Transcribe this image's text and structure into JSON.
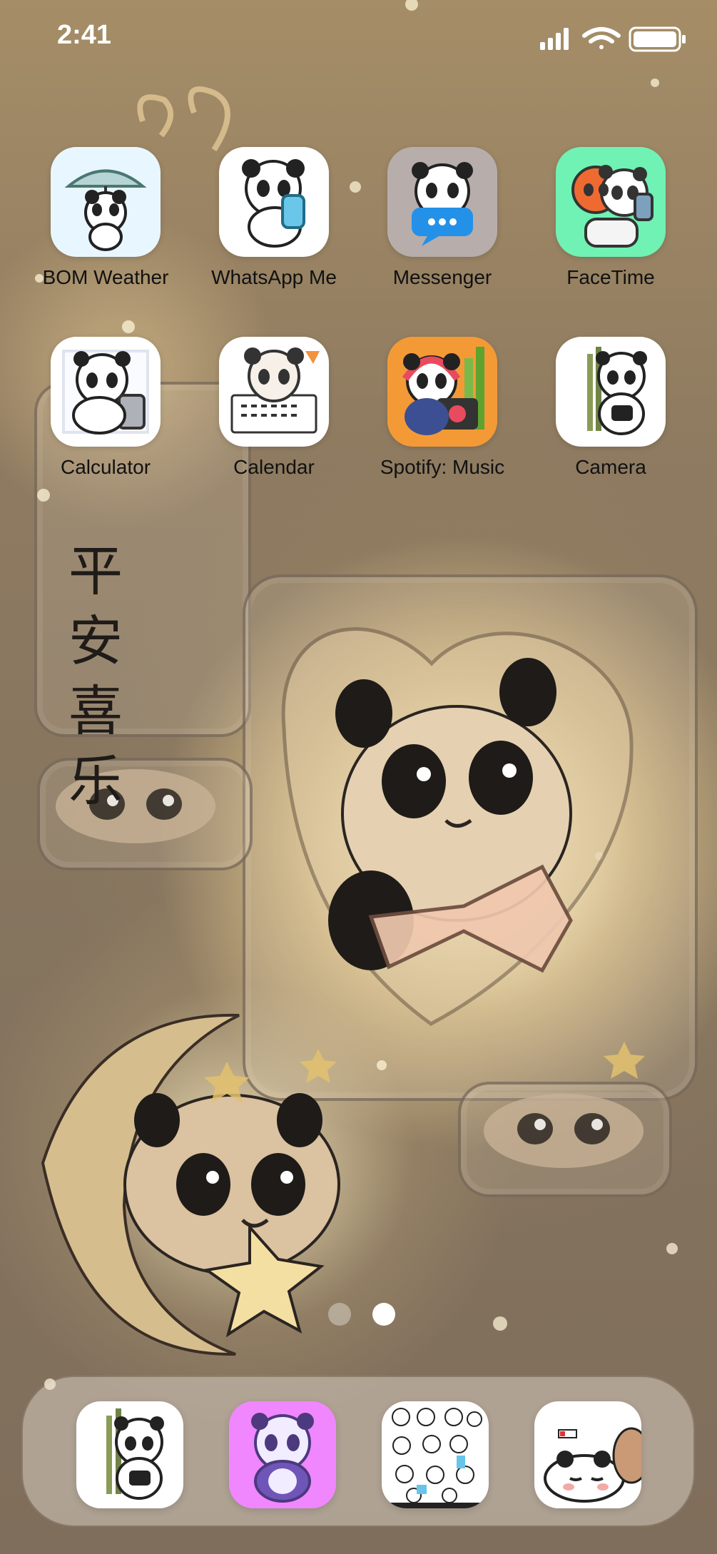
{
  "status_bar": {
    "time": "2:41",
    "signal_icon": "signal-icon",
    "wifi_icon": "wifi-icon",
    "battery_icon": "battery-icon"
  },
  "apps": [
    {
      "label": "BOM Weather",
      "icon": "panda-umbrella-icon"
    },
    {
      "label": "WhatsApp Me",
      "icon": "panda-phone-icon"
    },
    {
      "label": "Messenger",
      "icon": "panda-chat-icon"
    },
    {
      "label": "FaceTime",
      "icon": "panda-red-panda-selfie-icon"
    },
    {
      "label": "Calculator",
      "icon": "panda-calculator-icon"
    },
    {
      "label": "Calendar",
      "icon": "panda-calendar-icon"
    },
    {
      "label": "Spotify: Music",
      "icon": "panda-radio-icon"
    },
    {
      "label": "Camera",
      "icon": "panda-camera-icon"
    }
  ],
  "wallpaper_text": {
    "line1": "平 安",
    "line2": "喜 乐"
  },
  "page_indicator": {
    "current_page": 2,
    "total_pages": 2
  },
  "dock": [
    {
      "icon": "panda-camera-dock-icon"
    },
    {
      "icon": "purple-panda-dock-icon"
    },
    {
      "icon": "panda-stickers-dock-icon"
    },
    {
      "icon": "sleeping-panda-dock-icon"
    }
  ],
  "colors": {
    "label_text": "#111111",
    "status_text": "#ffffff",
    "wallpaper_warm": "#9f8864",
    "dock_glass": "#e8e1d6"
  }
}
